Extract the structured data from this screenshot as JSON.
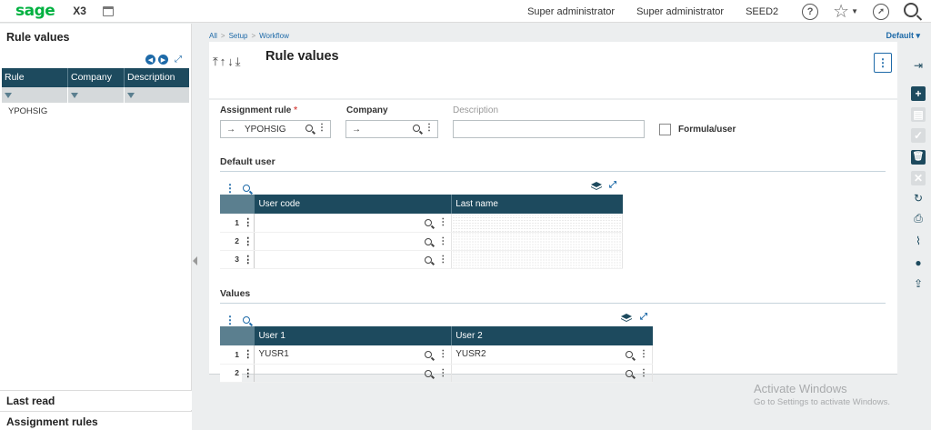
{
  "topbar": {
    "logo": "sage",
    "product": "X3",
    "user1": "Super administrator",
    "user2": "Super administrator",
    "folder": "SEED2",
    "help_glyph": "?",
    "icons": [
      "calendar-icon",
      "help-icon",
      "star-icon",
      "compass-icon",
      "search-icon"
    ]
  },
  "left": {
    "title": "Rule values",
    "columns": [
      "Rule",
      "Company",
      "Description"
    ],
    "rows": [
      {
        "rule": "YPOHSIG"
      }
    ],
    "footer1": "Last read",
    "footer2": "Assignment rules"
  },
  "breadcrumb": [
    "All",
    "Setup",
    "Workflow"
  ],
  "default_select": "Default",
  "page": {
    "title": "Rule values",
    "kebab": "⋮"
  },
  "form": {
    "assignment_rule_label": "Assignment rule",
    "assignment_rule_value": "YPOHSIG",
    "required_mark": "*",
    "company_label": "Company",
    "company_value": "",
    "description_label": "Description",
    "formula_label": "Formula/user",
    "arrow_glyph": "→"
  },
  "default_user": {
    "title": "Default user",
    "columns": [
      "User code",
      "Last name"
    ],
    "rows": [
      {
        "num": "1",
        "code": "",
        "name": ""
      },
      {
        "num": "2",
        "code": "",
        "name": ""
      },
      {
        "num": "3",
        "code": "",
        "name": ""
      }
    ]
  },
  "values": {
    "title": "Values",
    "columns": [
      "User 1",
      "User 2"
    ],
    "rows": [
      {
        "num": "1",
        "user1": "YUSR1",
        "user2": "YUSR2"
      },
      {
        "num": "2",
        "user1": "",
        "user2": ""
      }
    ]
  },
  "watermark": {
    "line1": "Activate Windows",
    "line2": "Go to Settings to activate Windows."
  },
  "colors": {
    "header": "#1d4a5e",
    "accent": "#1e6aa8",
    "brand": "#00b140"
  }
}
